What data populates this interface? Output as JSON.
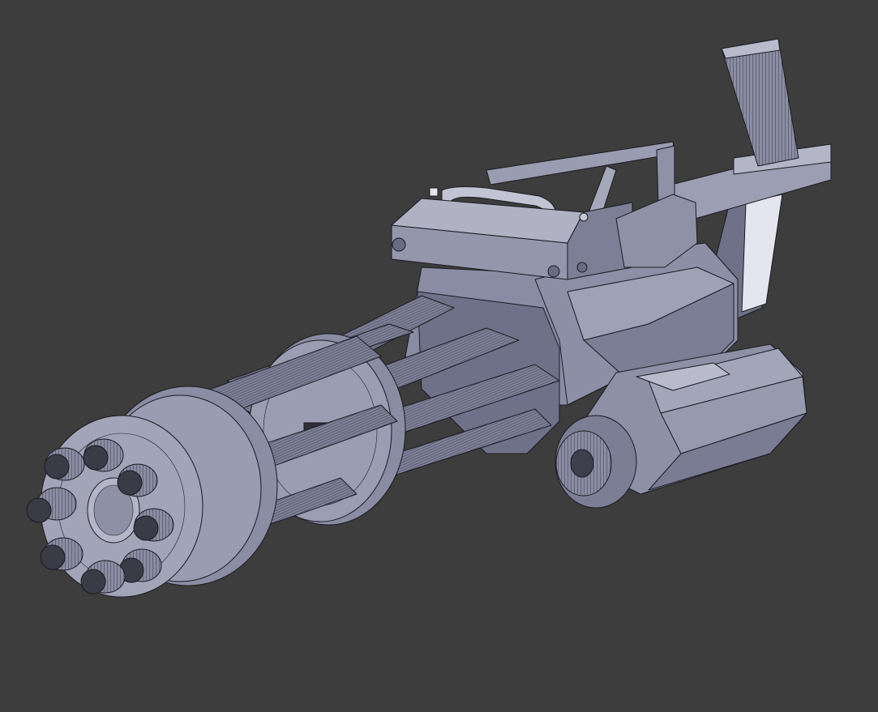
{
  "viewport": {
    "background": "#3d3d3d",
    "render_mode": "wireframe-over-solid",
    "object": "minigun-3d-model"
  },
  "colors": {
    "mesh_base": "#8d8fa6",
    "mesh_light": "#a9abbe",
    "mesh_dark": "#6f7188",
    "mesh_shadow": "#55576a",
    "wire": "#1a1a22",
    "highlight": "#e4e5ee"
  },
  "model": {
    "barrel_count": 8,
    "rear_barrel_count": 6,
    "disc_count": 3
  }
}
